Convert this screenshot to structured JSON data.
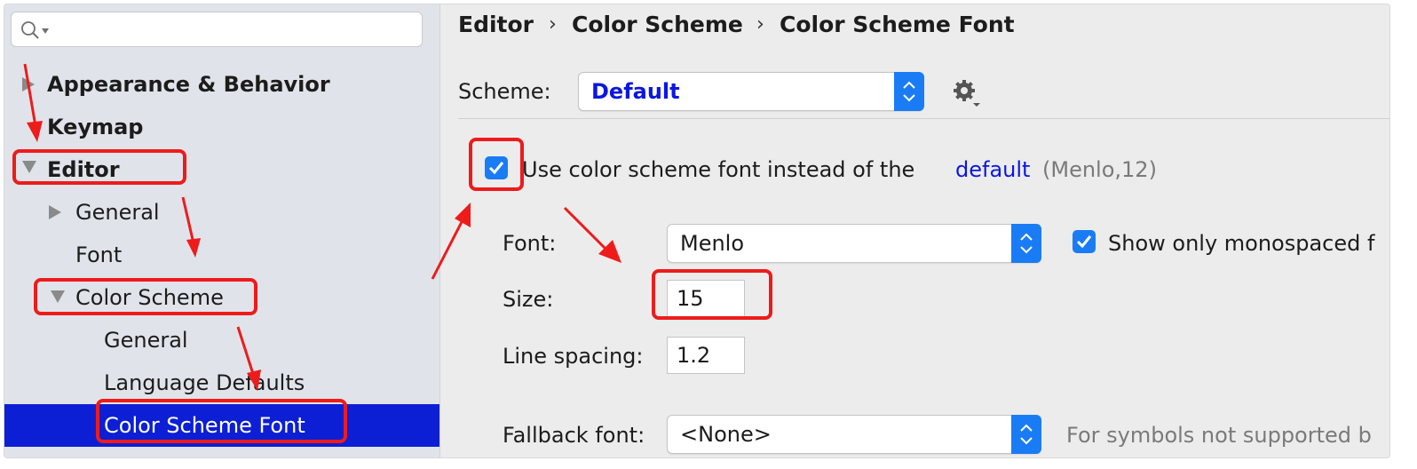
{
  "sidebar": {
    "search": {
      "placeholder": ""
    },
    "items": [
      {
        "label": "Appearance & Behavior"
      },
      {
        "label": "Keymap"
      },
      {
        "label": "Editor"
      },
      {
        "label": "General"
      },
      {
        "label": "Font"
      },
      {
        "label": "Color Scheme"
      },
      {
        "label": "General"
      },
      {
        "label": "Language Defaults"
      },
      {
        "label": "Color Scheme Font"
      }
    ]
  },
  "breadcrumb": {
    "items": [
      "Editor",
      "Color Scheme",
      "Color Scheme Font"
    ],
    "separator": "›"
  },
  "scheme": {
    "label": "Scheme:",
    "value": "Default"
  },
  "use_scheme_font": {
    "checked": true,
    "text": "Use color scheme font instead of the",
    "link": "default",
    "hint": "(Menlo,12)"
  },
  "font": {
    "label": "Font:",
    "value": "Menlo",
    "mono_label": "Show only monospaced f",
    "mono_checked": true
  },
  "size": {
    "label": "Size:",
    "value": "15"
  },
  "line_spacing": {
    "label": "Line spacing:",
    "value": "1.2"
  },
  "fallback": {
    "label": "Fallback font:",
    "value": "<None>",
    "hint": "For symbols not supported b"
  },
  "colors": {
    "selection": "#0d1fd4",
    "link": "#0b17e0",
    "accent": "#1a7cf5",
    "annotation": "#ee1b1b"
  },
  "icons": [
    "search-icon",
    "gear-icon",
    "chevron-updown-icon",
    "checkmark-icon"
  ]
}
